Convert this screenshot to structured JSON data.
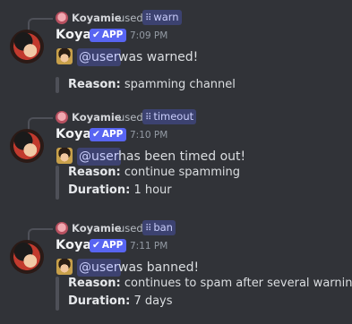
{
  "messages": [
    {
      "reply": {
        "user": "Koyamie",
        "used": "used",
        "command": "warn"
      },
      "author": "Koya",
      "app_tag": "APP",
      "time": "7:09 PM",
      "mention": "@user",
      "text": "was warned!",
      "fields": [
        {
          "label": "Reason:",
          "value": "spamming channel"
        }
      ]
    },
    {
      "reply": {
        "user": "Koyamie",
        "used": "used",
        "command": "timeout"
      },
      "author": "Koya",
      "app_tag": "APP",
      "time": "7:10 PM",
      "mention": "@user",
      "text": "has been timed out!",
      "fields": [
        {
          "label": "Reason:",
          "value": "continue spamming"
        },
        {
          "label": "Duration:",
          "value": "1 hour"
        }
      ]
    },
    {
      "reply": {
        "user": "Koyamie",
        "used": "used",
        "command": "ban"
      },
      "author": "Koya",
      "app_tag": "APP",
      "time": "7:11 PM",
      "mention": "@user",
      "text": "was banned!",
      "fields": [
        {
          "label": "Reason:",
          "value": "continues to spam after several warnings"
        },
        {
          "label": "Duration:",
          "value": "7 days"
        }
      ]
    }
  ],
  "colors": {
    "background": "#313338",
    "app_tag": "#5865f2",
    "mention_bg": "#3d4270",
    "mention_text": "#c9cdfb",
    "quote_bar": "#4e5058"
  },
  "icons": {
    "check": "check-icon",
    "slash_command": "slash-command-icon"
  }
}
